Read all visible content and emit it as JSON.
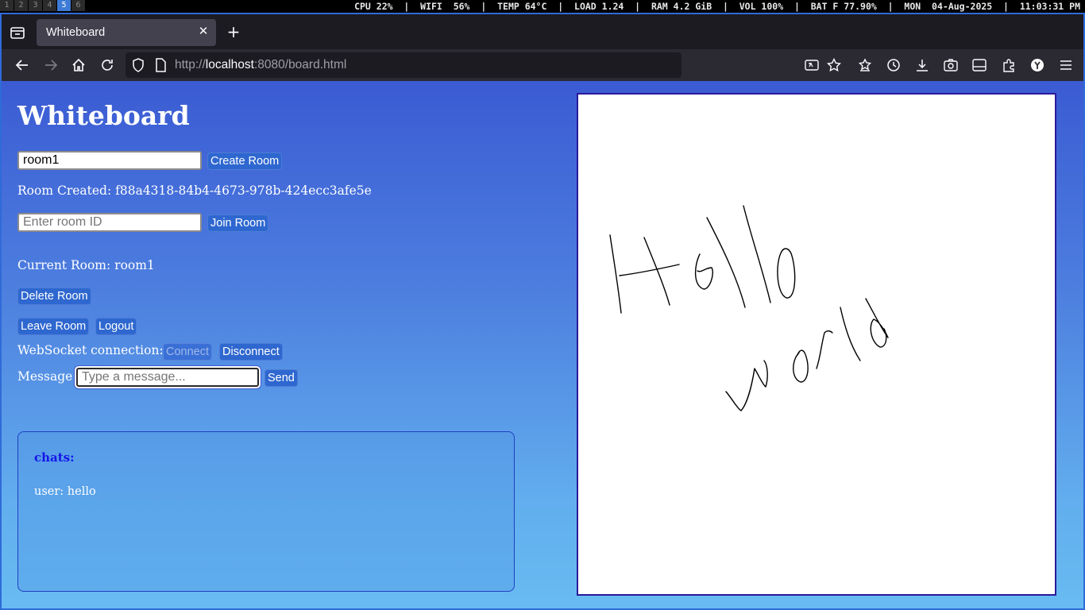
{
  "status_bar": {
    "workspaces": [
      "1",
      "2",
      "3",
      "4",
      "5",
      "6"
    ],
    "active_workspace": "5",
    "text": "CPU 22%  |  WIFI  56%  |  TEMP 64°C  |  LOAD 1.24  |  RAM 4.2 GiB  |  VOL 100%  |  BAT F 77.90%  |  MON  04-Aug-2025  |  11:03:31 PM"
  },
  "browser": {
    "tab_title": "Whiteboard",
    "url_prefix": "http://",
    "url_host": "localhost",
    "url_rest": ":8080/board.html",
    "icons": [
      "tab-list-icon",
      "close-icon",
      "plus-icon",
      "back-arrow-icon",
      "forward-arrow-icon",
      "home-icon",
      "reload-icon",
      "shield-icon",
      "page-icon",
      "translate-icon",
      "star-icon",
      "bookmarks-icon",
      "history-icon",
      "download-icon",
      "screenshot-icon",
      "sidebar-icon",
      "extensions-icon",
      "account-icon",
      "menu-icon"
    ]
  },
  "page": {
    "title": "Whiteboard",
    "room_name_value": "room1",
    "create_room_label": "Create Room",
    "room_created_text": "Room Created: f88a4318-84b4-4673-978b-424ecc3afe5e",
    "room_id_placeholder": "Enter room ID",
    "join_room_label": "Join Room",
    "current_room_text": "Current Room: room1",
    "delete_room_label": "Delete Room",
    "leave_room_label": "Leave Room",
    "logout_label": "Logout",
    "ws_label": "WebSocket connection:",
    "connect_label": "Connect",
    "disconnect_label": "Disconnect",
    "message_label": "Message:",
    "message_placeholder": "Type a message...",
    "send_label": "Send",
    "chats_title": "chats:",
    "chat_messages": [
      "user: hello"
    ],
    "canvas_drawing": "Hello world"
  },
  "colors": {
    "page_gradient_top": "#3b5bd3",
    "page_gradient_bottom": "#68bbf2",
    "button": "#2e67cf",
    "chats_title": "#1515e8",
    "canvas_border": "#2a1a9a"
  }
}
